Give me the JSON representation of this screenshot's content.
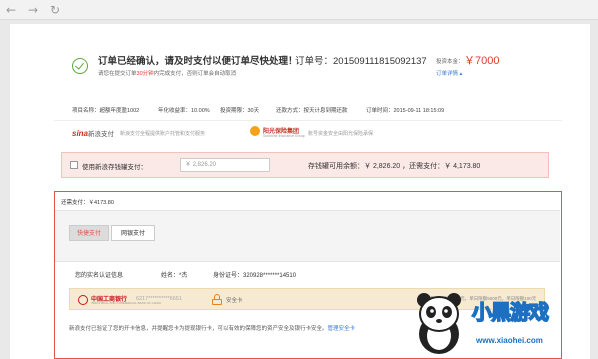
{
  "nav": {
    "back_icon": "←",
    "forward_icon": "→",
    "reload_icon": "↻"
  },
  "order": {
    "title": "订单已经确认，请及时支付以便订单尽快处理！",
    "subtitle_pre": "请您在提交订单",
    "subtitle_time": "30分钟",
    "subtitle_post": "内完成支付，否则订单会自动取消",
    "order_no": "订单号：2015091118150921​37",
    "amount_label": "投资本金：",
    "amount_value": "￥7000",
    "detail_link": "订单详情 ▴"
  },
  "info": {
    "project": "项目名称：超额年度盈1002",
    "rate": "年化收益率：10.00%",
    "period": "投资期限：30天",
    "repay": "还款方式：按天计息到期还款",
    "time": "订单时间：2015-09-11 18:15:09"
  },
  "logos": {
    "sina": "sina",
    "sina_cn": "新浪支付",
    "sina_desc": "新浪支付全程提供账户托管和支付服务",
    "sun_name": "阳光保险集团",
    "sun_en": "Sunshine Insurance Group",
    "sun_desc": "账号资金安全由阳光保险承保"
  },
  "balance": {
    "label": "使用新浪存钱罐支付：",
    "placeholder": "￥ 2,826.20",
    "right_text": "存钱罐可用余额：￥ 2,826.20 ，还需支付：￥ 4,173.80"
  },
  "payment": {
    "due": "还需支付：￥4173.80",
    "tabs": [
      "快捷支付",
      "网银支付"
    ],
    "real_name_label": "您的实名认证信息",
    "name": "姓名：*杰",
    "id": "身份证号：320928*******14510",
    "bank_name": "中国工商银行",
    "bank_en": "INDUSTRIAL AND COMMERCIAL BANK OF CHINA",
    "card_no": "6217**********6651",
    "safe_card": "安全卡",
    "limit": "*单笔支付限额500元，单日限额5000元，单日限额100元",
    "notice_pre": "新浪支付已验证了您的开卡信息，并提醒您卡为提现银行卡，可以有效的保障您的资产安全及银行卡安全。",
    "notice_link": "管理安全卡"
  },
  "watermark": {
    "text": "小黑游戏",
    "url": "www.xiaohei.com"
  },
  "colors": {
    "accent_red": "#e2554a",
    "price_red": "#e23b2e",
    "link_blue": "#3a7bd5",
    "success_green": "#5aa83f"
  }
}
